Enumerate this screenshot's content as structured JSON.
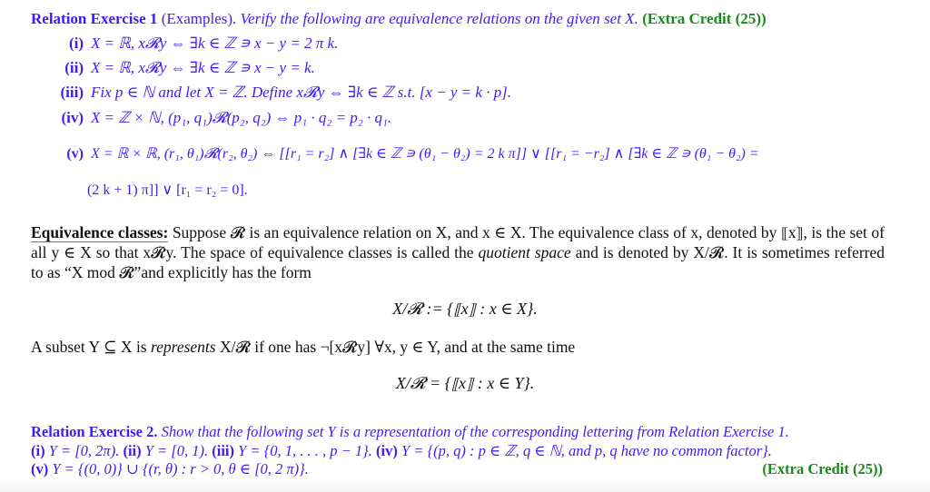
{
  "colors": {
    "exercise_text": "#3a1ff5",
    "extra_credit": "#1a8a1a",
    "body_text": "#111111"
  },
  "exercise1": {
    "title": "Relation Exercise 1",
    "subtitle": "(Examples).",
    "instruction": "Verify the following are equivalence relations on the given set X.",
    "extra_credit": "(Extra Credit (25))",
    "items": [
      {
        "label": "(i)",
        "text": "X = ℝ, x𝓡y  ⇔ ∃k ∈ ℤ ∍ x − y = 2 π k."
      },
      {
        "label": "(ii)",
        "text": "X = ℝ, x𝓡y  ⇔ ∃k ∈ ℤ ∍ x − y = k."
      },
      {
        "label": "(iii)",
        "text": "Fix p ∈ ℕ and let X = ℤ. Define x𝓡y  ⇔ ∃k ∈ ℤ s.t. [x − y = k · p]."
      },
      {
        "label": "(iv)",
        "text": "X = ℤ × ℕ, (p₁, q₁)𝓡(p₂, q₂) ⇔ p₁ · q₂ = p₂ · q₁."
      },
      {
        "label": "(v)",
        "text": "X = ℝ × ℝ, (r₁, θ₁)𝓡(r₂, θ₂) ⇔ [[r₁ = r₂] ∧ [∃k ∈ ℤ ∍ (θ₁ − θ₂) = 2 k π]] ∨ [[r₁ = −r₂] ∧ [∃k ∈ ℤ ∍ (θ₁ − θ₂) ="
      },
      {
        "label": "",
        "text": "(2 k + 1) π]] ∨ [r₁ = r₂ = 0]."
      }
    ]
  },
  "equivalence_classes": {
    "heading": "Equivalence classes:",
    "paragraph_1": "Suppose 𝓡 is an equivalence relation on X, and x ∈ X. The equivalence class of x, denoted by ⟦x⟧, is the set of all y ∈ X so that x𝓡y. The space of equivalence classes is called the",
    "emphasis_1": "quotient space",
    "paragraph_1_end": "and is denoted by X/𝓡. It is sometimes referred to as “X mod 𝓡”and explicitly has the form",
    "formula_1": "X/𝓡 := {⟦x⟧ : x ∈ X}.",
    "paragraph_2_start": "A subset Y ⊆ X is",
    "emphasis_2": "represents",
    "paragraph_2_end": "X/𝓡 if one has ¬[x𝓡y] ∀x, y ∈ Y, and at the same time",
    "formula_2": "X/𝓡 = {⟦x⟧ : x ∈ Y}."
  },
  "exercise2": {
    "title": "Relation Exercise 2.",
    "instruction": "Show that the following set Y is a representation of the corresponding lettering from Relation Exercise 1.",
    "line_2": [
      {
        "label": "(i)",
        "text": "Y = [0, 2π)."
      },
      {
        "label": "(ii)",
        "text": "Y = [0, 1)."
      },
      {
        "label": "(iii)",
        "text": "Y = {0, 1, . . . , p − 1}."
      },
      {
        "label": "(iv)",
        "text": "Y = {(p, q) : p ∈ ℤ, q ∈ ℕ,  and p, q have no common factor}."
      }
    ],
    "line_3": {
      "label": "(v)",
      "text": "Y = {(0, 0)} ∪ {(r, θ) : r > 0, θ ∈ [0, 2 π)}."
    },
    "extra_credit": "(Extra Credit (25))"
  }
}
